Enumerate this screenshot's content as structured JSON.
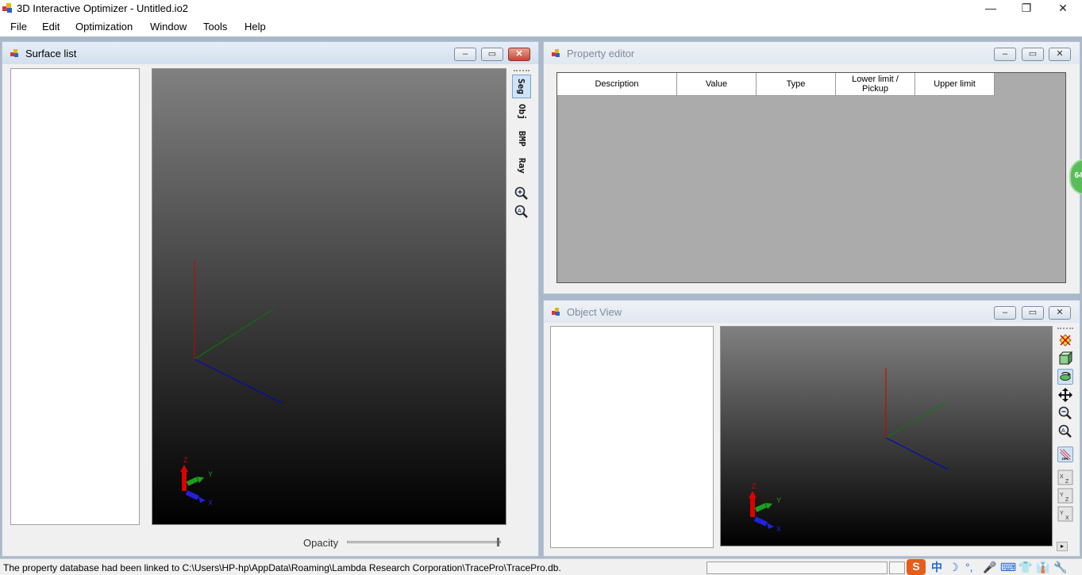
{
  "window": {
    "title": "3D Interactive Optimizer - Untitled.io2",
    "minimize": "—",
    "maximize": "❐",
    "close": "✕"
  },
  "menu": [
    "File",
    "Edit",
    "Optimization",
    "Window",
    "Tools",
    "Help"
  ],
  "surface_list": {
    "title": "Surface list",
    "vtabs": [
      "Seg",
      "Obj",
      "BMP",
      "Ray"
    ],
    "opacity_label": "Opacity",
    "opacity_value": 1.0
  },
  "property_editor": {
    "title": "Property editor",
    "columns": [
      "Description",
      "Value",
      "Type",
      "Lower limit / Pickup",
      "Upper limit"
    ]
  },
  "object_view": {
    "title": "Object View"
  },
  "axes": {
    "x": "X",
    "y": "Y",
    "z": "Z"
  },
  "mdi_buttons": {
    "min": "–",
    "restore": "▭",
    "close": "✕"
  },
  "side_badge": "64",
  "status": {
    "message": "The property database had been linked to C:\\Users\\HP-hp\\AppData\\Roaming\\Lambda Research Corporation\\TracePro\\TracePro.db."
  },
  "ime_tray": [
    "S",
    "中",
    "☽",
    "°,",
    "🎤",
    "⌨",
    "👕",
    "👔",
    "🔧"
  ],
  "colors": {
    "workspace": "#abb8c9",
    "axis_x": "#0000cc",
    "axis_y": "#008000",
    "axis_z": "#cc0000"
  }
}
